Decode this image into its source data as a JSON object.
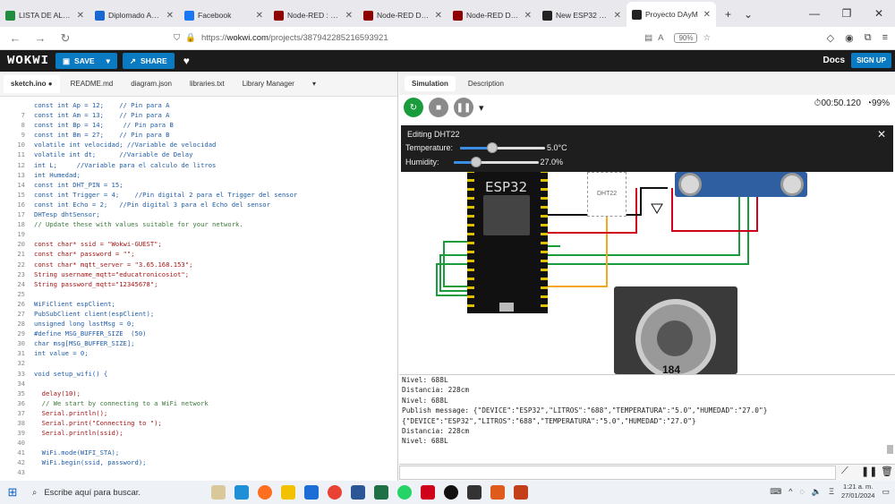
{
  "browser": {
    "tabs": [
      {
        "label": "LISTA DE ALUMN",
        "color": "#1e8e3e"
      },
      {
        "label": "Diplomado Autor",
        "color": "#1967d2"
      },
      {
        "label": "Facebook",
        "color": "#1877f2"
      },
      {
        "label": "Node-RED : Flow",
        "color": "#8f0000"
      },
      {
        "label": "Node-RED Dashb",
        "color": "#8f0000"
      },
      {
        "label": "Node-RED Dashb",
        "color": "#8f0000"
      },
      {
        "label": "New ESP32 Proje",
        "color": "#222222"
      },
      {
        "label": "Proyecto DAyM",
        "color": "#222222"
      }
    ],
    "url_prefix": "https://",
    "url_host": "wokwi.com",
    "url_path": "/projects/387942285216593921",
    "zoom": "90%"
  },
  "wokwi": {
    "logo": "WOKWI",
    "save": "SAVE",
    "share": "SHARE",
    "docs": "Docs",
    "signup": "SIGN UP",
    "files": [
      "sketch.ino ●",
      "README.md",
      "diagram.json",
      "libraries.txt",
      "Library Manager"
    ],
    "sim_tabs": [
      "Simulation",
      "Description"
    ],
    "timer": "00:50.120",
    "cpu": "99%",
    "dht_panel": {
      "title": "Editing DHT22",
      "temp_label": "Temperature:",
      "temp_value": "5.0°C",
      "temp_level": 0.38,
      "hum_label": "Humidity:",
      "hum_value": "27.0%",
      "hum_level": 0.27
    },
    "board_label": "ESP32",
    "dht_part": "DHT22",
    "motor_number": "184"
  },
  "code_lines": [
    {
      "n": "",
      "t": "const int Ap = 12;    // Pin para A",
      "c": "ct"
    },
    {
      "n": "7",
      "t": "const int Am = 13;    // Pin para A",
      "c": "ct"
    },
    {
      "n": "8",
      "t": "const int Bp = 14;     // Pin para B",
      "c": "ct"
    },
    {
      "n": "9",
      "t": "const int Bm = 27;    // Pin para B",
      "c": "ct"
    },
    {
      "n": "10",
      "t": "volatile int velocidad; //Variable de velocidad",
      "c": "ct"
    },
    {
      "n": "11",
      "t": "volatile int dt;      //Variable de Delay",
      "c": "ct"
    },
    {
      "n": "12",
      "t": "int L;     //Variable para el calculo de litros",
      "c": "ct"
    },
    {
      "n": "13",
      "t": "int Humedad;",
      "c": "ct"
    },
    {
      "n": "14",
      "t": "const int DHT_PIN = 15;",
      "c": "ct"
    },
    {
      "n": "15",
      "t": "const int Trigger = 4;    //Pin digital 2 para el Trigger del sensor",
      "c": "ct"
    },
    {
      "n": "16",
      "t": "const int Echo = 2;   //Pin digital 3 para el Echo del sensor",
      "c": "ct"
    },
    {
      "n": "17",
      "t": "DHTesp dhtSensor;",
      "c": "ct"
    },
    {
      "n": "18",
      "t": "// Update these with values suitable for your network.",
      "c": "ct cm"
    },
    {
      "n": "19",
      "t": "",
      "c": "ct"
    },
    {
      "n": "20",
      "t": "const char* ssid = \"Wokwi-GUEST\";",
      "c": "ct st"
    },
    {
      "n": "21",
      "t": "const char* password = \"\";",
      "c": "ct st"
    },
    {
      "n": "22",
      "t": "const char* mqtt_server = \"3.65.168.153\";",
      "c": "ct st"
    },
    {
      "n": "23",
      "t": "String username_mqtt=\"educatronicosiot\";",
      "c": "ct st"
    },
    {
      "n": "24",
      "t": "String password_mqtt=\"12345678\";",
      "c": "ct st"
    },
    {
      "n": "25",
      "t": "",
      "c": "ct"
    },
    {
      "n": "26",
      "t": "WiFiClient espClient;",
      "c": "ct"
    },
    {
      "n": "27",
      "t": "PubSubClient client(espClient);",
      "c": "ct"
    },
    {
      "n": "28",
      "t": "unsigned long lastMsg = 0;",
      "c": "ct"
    },
    {
      "n": "29",
      "t": "#define MSG_BUFFER_SIZE  (50)",
      "c": "ct"
    },
    {
      "n": "30",
      "t": "char msg[MSG_BUFFER_SIZE];",
      "c": "ct"
    },
    {
      "n": "31",
      "t": "int value = 0;",
      "c": "ct"
    },
    {
      "n": "32",
      "t": "",
      "c": "ct"
    },
    {
      "n": "33",
      "t": "void setup_wifi() {",
      "c": "ct"
    },
    {
      "n": "34",
      "t": "",
      "c": "ct"
    },
    {
      "n": "35",
      "t": "  delay(10);",
      "c": "ct st"
    },
    {
      "n": "36",
      "t": "  // We start by connecting to a WiFi network",
      "c": "ct cm"
    },
    {
      "n": "37",
      "t": "  Serial.println();",
      "c": "ct st"
    },
    {
      "n": "38",
      "t": "  Serial.print(\"Connecting to \");",
      "c": "ct st"
    },
    {
      "n": "39",
      "t": "  Serial.println(ssid);",
      "c": "ct st"
    },
    {
      "n": "40",
      "t": "",
      "c": "ct"
    },
    {
      "n": "41",
      "t": "  WiFi.mode(WIFI_STA);",
      "c": "ct"
    },
    {
      "n": "42",
      "t": "  WiFi.begin(ssid, password);",
      "c": "ct"
    },
    {
      "n": "43",
      "t": "",
      "c": "ct"
    }
  ],
  "serial_lines": [
    "Nivel: 688L",
    "Distancia: 228cm",
    "Nivel: 688L",
    "Publish message: {\"DEVICE\":\"ESP32\",\"LITROS\":\"688\",\"TEMPERATURA\":\"5.0\",\"HUMEDAD\":\"27.0\"}",
    "{\"DEVICE\":\"ESP32\",\"LITROS\":\"688\",\"TEMPERATURA\":\"5.0\",\"HUMEDAD\":\"27.0\"}",
    "Distancia: 228cm",
    "Nivel: 688L"
  ],
  "taskbar": {
    "search": "Escribe aquí para buscar.",
    "time": "1:21 a. m.",
    "date": "27/01/2024"
  }
}
